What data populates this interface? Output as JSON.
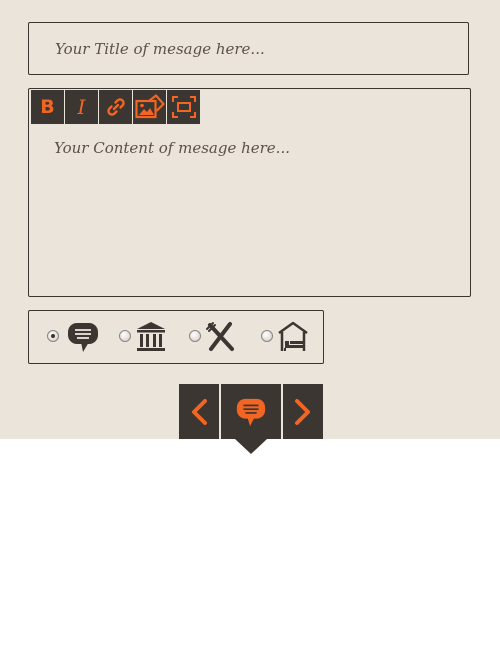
{
  "form": {
    "title_placeholder": "Your Title of mesage here...",
    "content_placeholder": "Your Content of mesage here..."
  },
  "toolbar": {
    "buttons": [
      {
        "icon": "bold-icon",
        "label": "B"
      },
      {
        "icon": "italic-icon",
        "label": "I"
      },
      {
        "icon": "link-icon"
      },
      {
        "icon": "insert-image-icon"
      },
      {
        "icon": "fullscreen-icon"
      }
    ]
  },
  "categories": {
    "options": [
      {
        "icon": "speech-bubble-icon",
        "selected": true
      },
      {
        "icon": "bank-icon",
        "selected": false
      },
      {
        "icon": "restaurant-icon",
        "selected": false
      },
      {
        "icon": "hotel-icon",
        "selected": false
      }
    ]
  },
  "navigation": {
    "prev_icon": "chevron-left-icon",
    "current_icon": "speech-bubble-icon",
    "next_icon": "chevron-right-icon"
  },
  "colors": {
    "accent": "#f26522",
    "dark": "#3b3631",
    "panel_bg": "#ebe4da"
  }
}
